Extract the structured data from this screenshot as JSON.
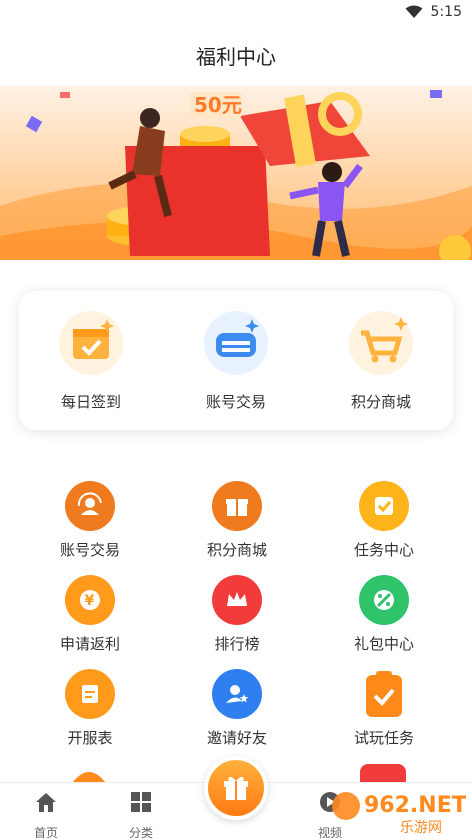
{
  "status_bar": {
    "time": "5:15"
  },
  "header": {
    "title": "福利中心"
  },
  "banner": {
    "amount_text": "50元"
  },
  "quick_actions": [
    {
      "label": "每日签到",
      "icon": "calendar-check-icon",
      "bg": "#fff3e0",
      "color": "#ffb23d"
    },
    {
      "label": "账号交易",
      "icon": "account-trade-icon",
      "bg": "#e8f2ff",
      "color": "#3c8cf0"
    },
    {
      "label": "积分商城",
      "icon": "shopping-cart-icon",
      "bg": "#fff3e0",
      "color": "#ffb23d"
    }
  ],
  "grid": [
    {
      "label": "账号交易",
      "icon": "account-exchange-icon",
      "color": "#f07a1e"
    },
    {
      "label": "积分商城",
      "icon": "gift-box-icon",
      "color": "#f07a1e"
    },
    {
      "label": "任务中心",
      "icon": "task-check-icon",
      "color": "#ffb41a"
    },
    {
      "label": "申请返利",
      "icon": "yen-coin-icon",
      "color": "#ff9a1a"
    },
    {
      "label": "排行榜",
      "icon": "crown-icon",
      "color": "#f23c3c"
    },
    {
      "label": "礼包中心",
      "icon": "gift-pack-icon",
      "color": "#2fc46a"
    },
    {
      "label": "开服表",
      "icon": "server-list-icon",
      "color": "#ff9a1a"
    },
    {
      "label": "邀请好友",
      "icon": "invite-friend-icon",
      "color": "#2f7ff0"
    },
    {
      "label": "试玩任务",
      "icon": "trial-task-icon",
      "color": "#ff8a1a"
    }
  ],
  "tabs": [
    {
      "label": "首页",
      "icon": "home-icon"
    },
    {
      "label": "分类",
      "icon": "category-grid-icon"
    },
    {
      "label": "视频",
      "icon": "video-icon"
    }
  ],
  "watermark": {
    "text": "962.NET",
    "subtext": "乐游网"
  }
}
